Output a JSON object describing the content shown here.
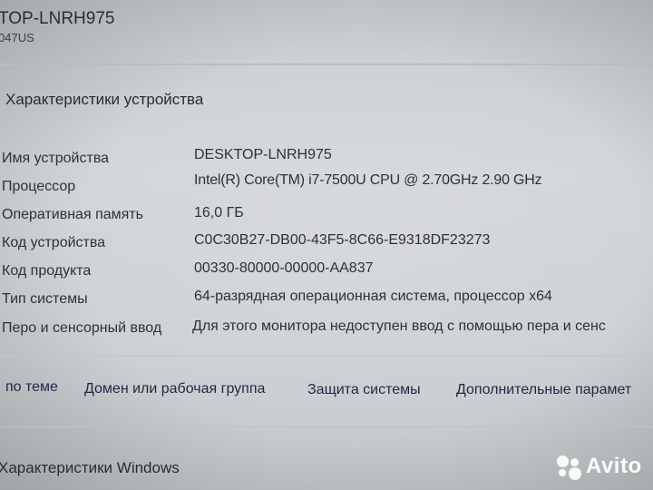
{
  "window": {
    "title": "TOP-LNRH975",
    "subtitle": "047US"
  },
  "device_specs": {
    "heading": "Характеристики устройства",
    "rows": [
      {
        "label": "Имя устройства",
        "value": "DESKTOP-LNRH975"
      },
      {
        "label": "Процессор",
        "value": "Intel(R) Core(TM) i7-7500U CPU @ 2.70GHz   2.90 GHz"
      },
      {
        "label": "Оперативная память",
        "value": "16,0 ГБ"
      },
      {
        "label": "Код устройства",
        "value": "C0C30B27-DB00-43F5-8C66-E9318DF23273"
      },
      {
        "label": "Код продукта",
        "value": "00330-80000-00000-AA837"
      },
      {
        "label": "Тип системы",
        "value": "64-разрядная операционная система, процессор x64"
      },
      {
        "label": "Перо и сенсорный ввод",
        "value": "Для этого монитора недоступен ввод с помощью пера и сенс"
      }
    ]
  },
  "related_links": [
    {
      "label": "по теме"
    },
    {
      "label": "Домен или рабочая группа"
    },
    {
      "label": "Защита системы"
    },
    {
      "label": "Дополнительные парамет"
    }
  ],
  "windows_specs": {
    "heading": "Характеристики Windows"
  },
  "watermark": {
    "text": "Avito",
    "icon": "avito-logo-icon"
  }
}
